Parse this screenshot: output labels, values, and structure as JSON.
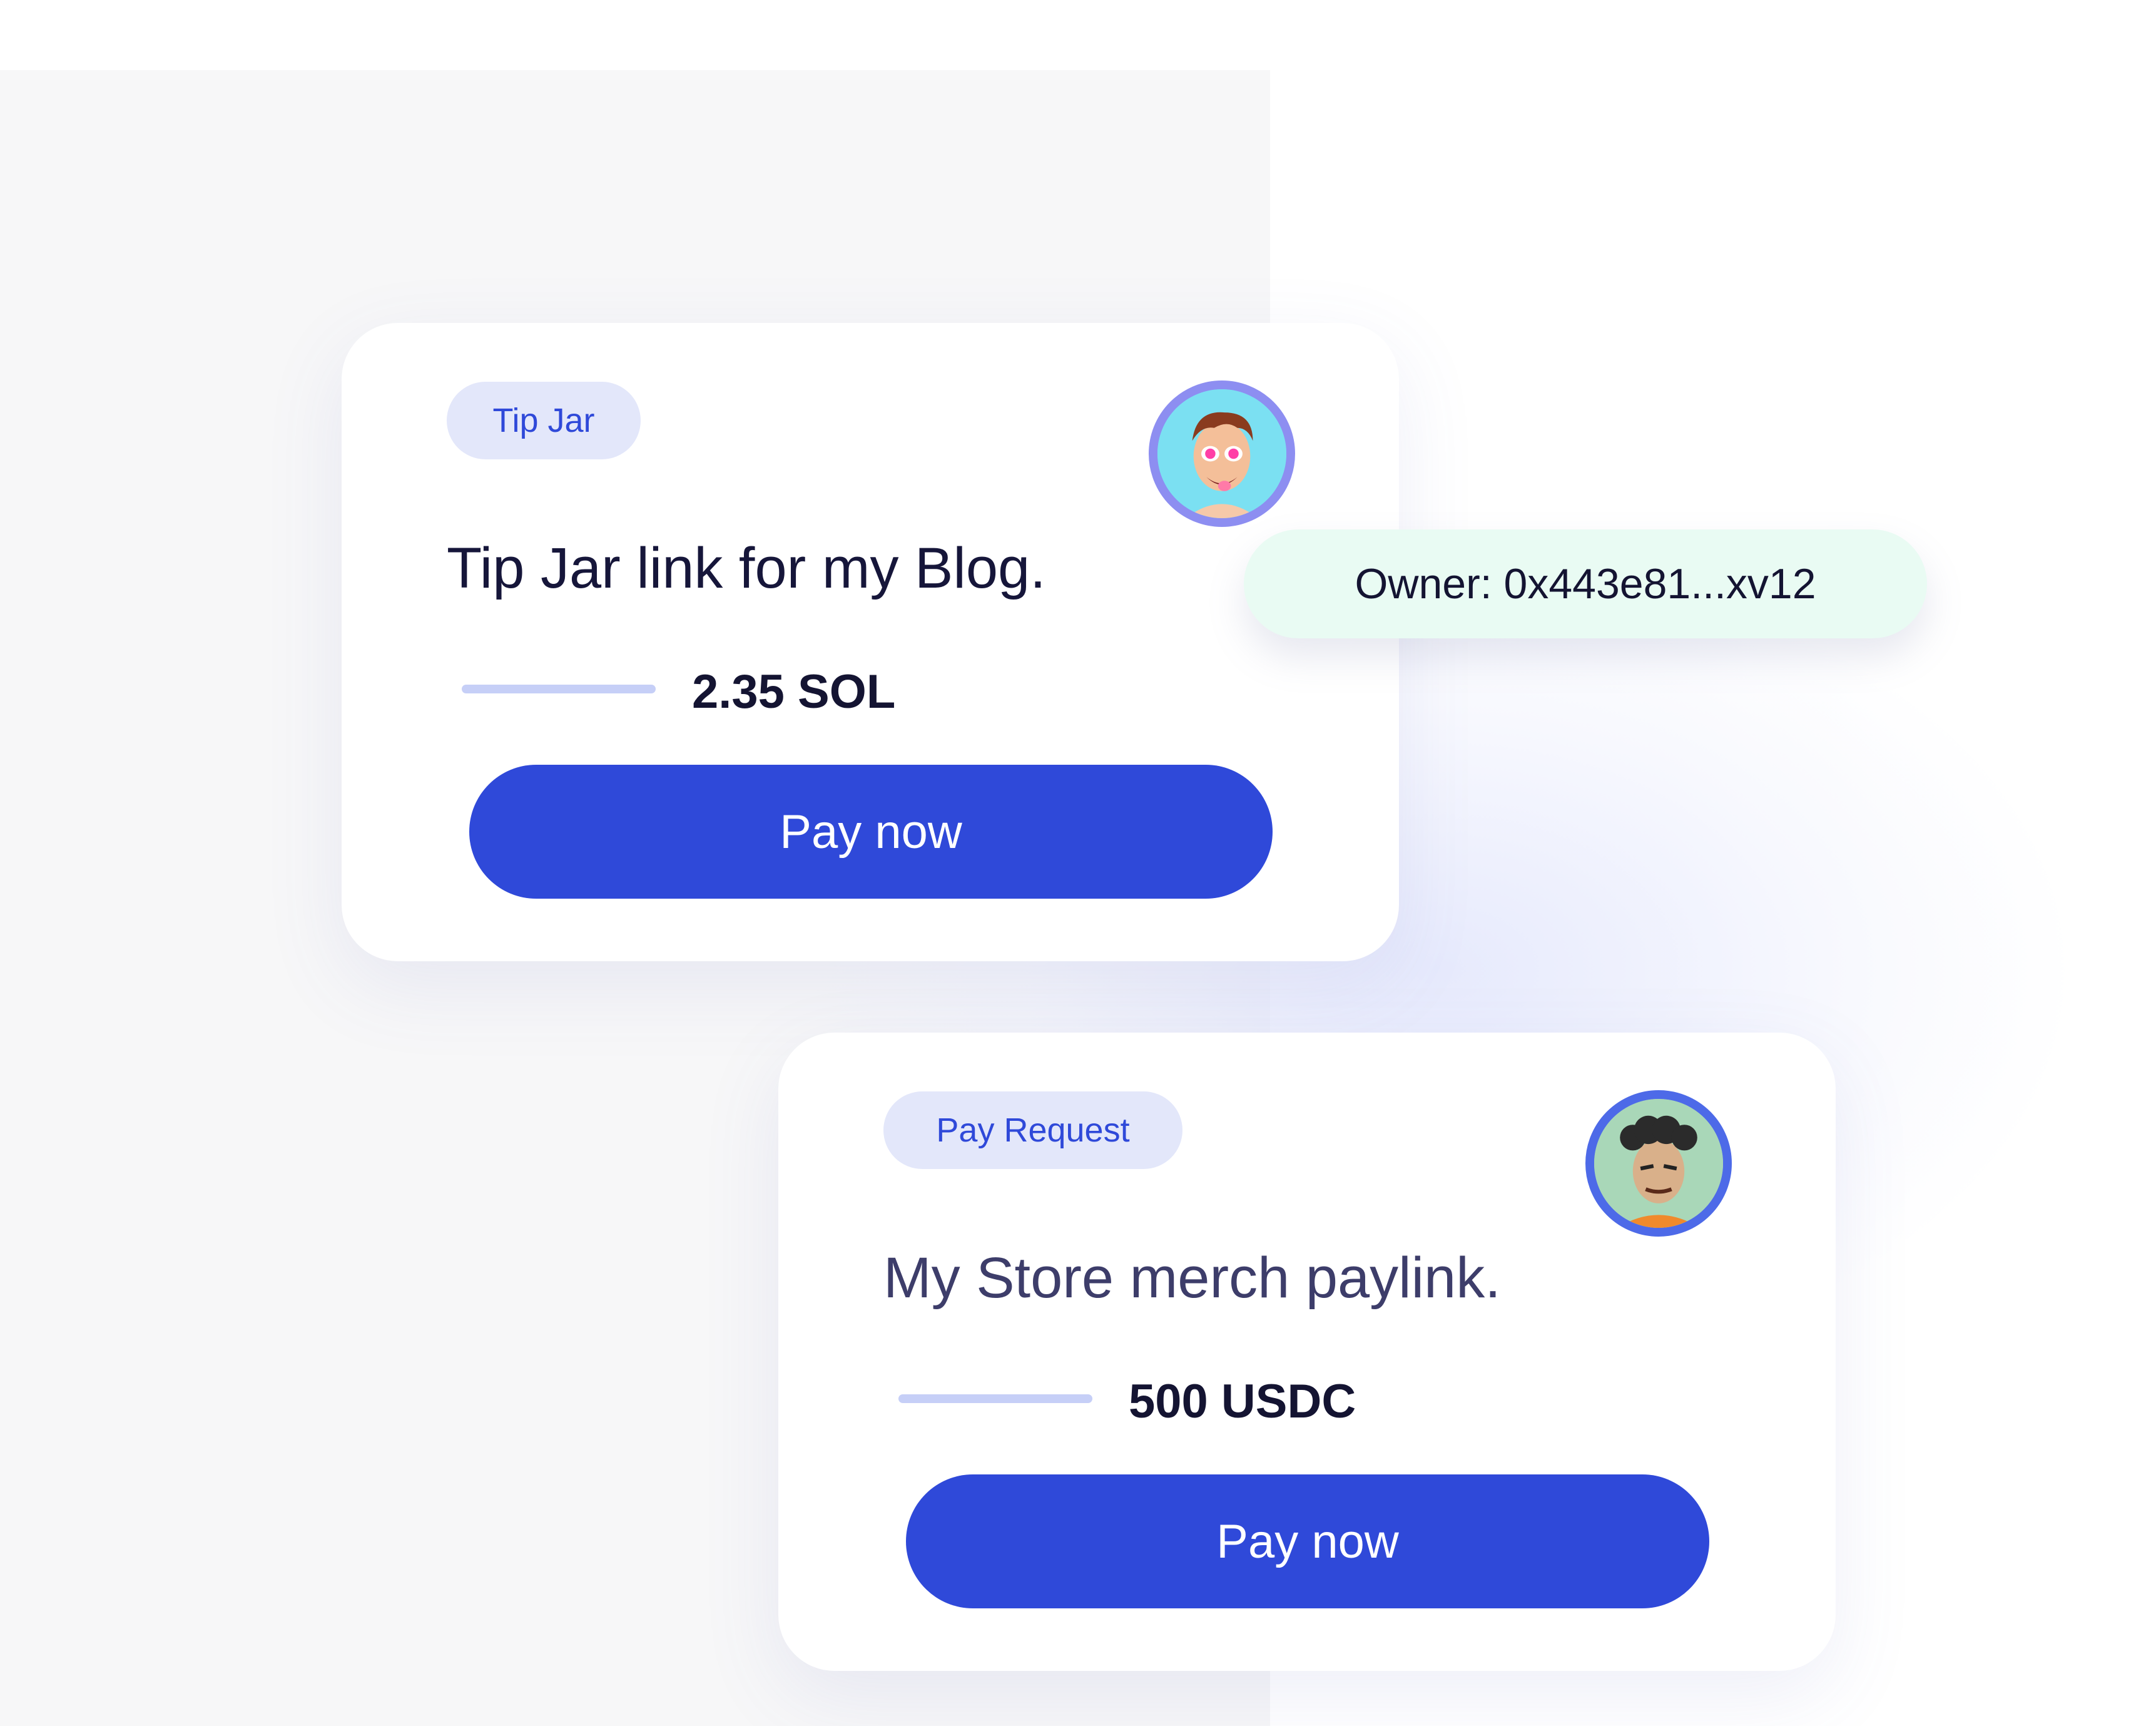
{
  "tip_card": {
    "tag": "Tip Jar",
    "description": "Tip Jar link for my Blog.",
    "amount": "2.35 SOL",
    "button_label": "Pay now",
    "avatar_icon": "cartoon-avatar-boy-icon"
  },
  "owner_pill": {
    "text": "Owner: 0x443e81...xv12"
  },
  "pay_card": {
    "tag": "Pay Request",
    "description": "My Store merch paylink.",
    "amount": "500 USDC",
    "button_label": "Pay now",
    "avatar_icon": "cartoon-avatar-man-icon"
  },
  "colors": {
    "primary": "#2f49d9",
    "tag_bg": "#e3e7fa",
    "owner_bg": "#e9fbf3"
  }
}
